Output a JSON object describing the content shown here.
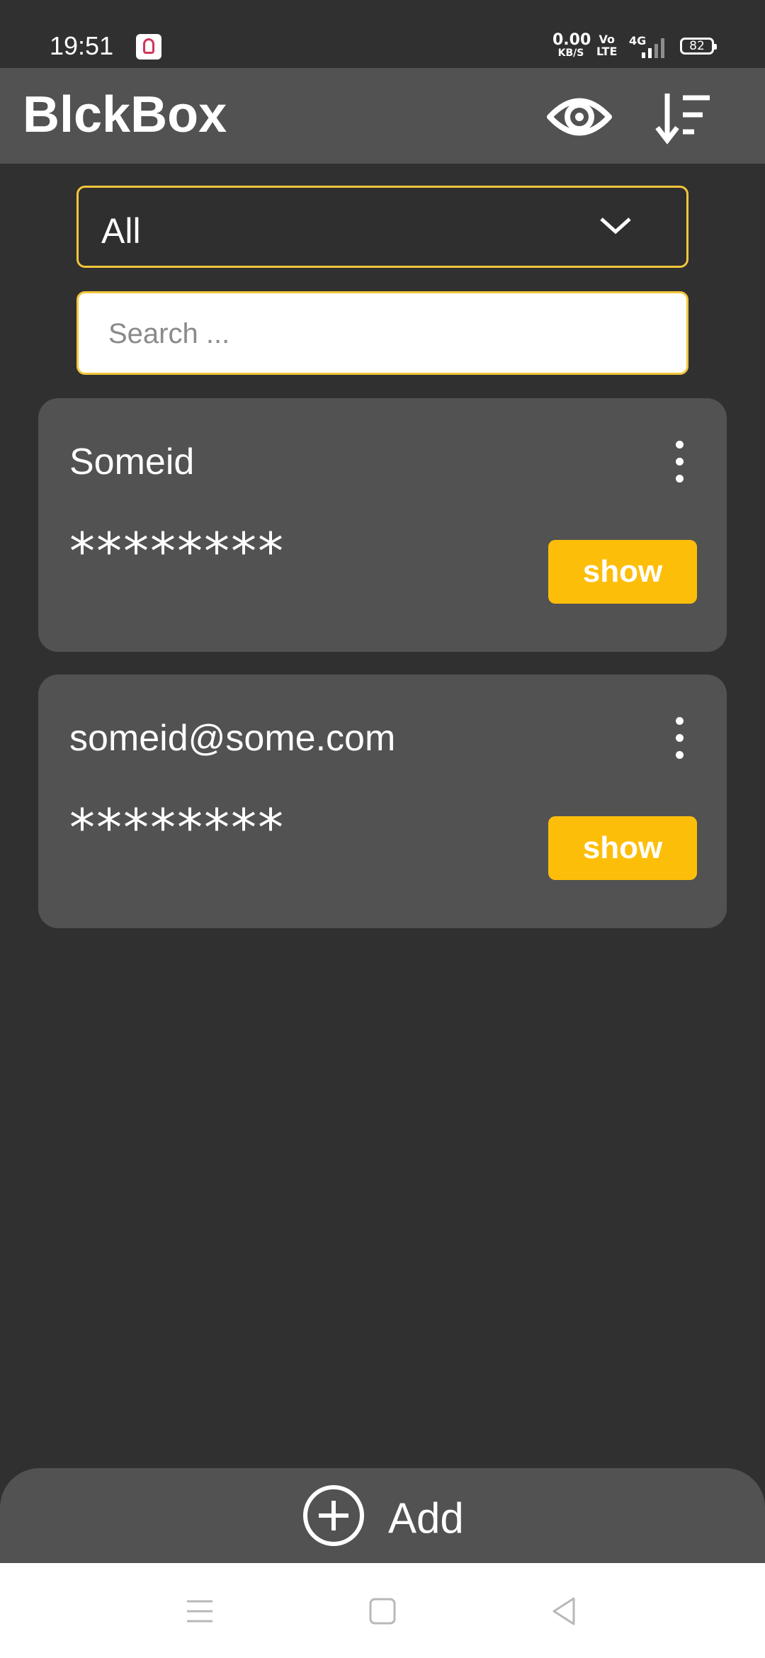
{
  "status_bar": {
    "time": "19:51",
    "net_speed_value": "0.00",
    "net_speed_unit": "KB/S",
    "volte_top": "Vo",
    "volte_bottom": "LTE",
    "network_type": "4G",
    "battery": "82"
  },
  "app_bar": {
    "title": "BlckBox",
    "visibility_icon": "eye-icon",
    "sort_icon": "sort-icon"
  },
  "filter": {
    "selected": "All"
  },
  "search": {
    "placeholder": "Search ..."
  },
  "entries": [
    {
      "title": "Someid",
      "masked": "********",
      "button": "show"
    },
    {
      "title": "someid@some.com",
      "masked": "********",
      "button": "show"
    }
  ],
  "add_bar": {
    "label": "Add",
    "icon": "plus-circle-icon"
  },
  "nav": {
    "menu_icon": "menu-icon",
    "home_icon": "home-icon",
    "back_icon": "back-icon"
  },
  "colors": {
    "background": "#303030",
    "surface": "#525252",
    "accent": "#fdbe0a",
    "outline": "#f3c63b"
  }
}
